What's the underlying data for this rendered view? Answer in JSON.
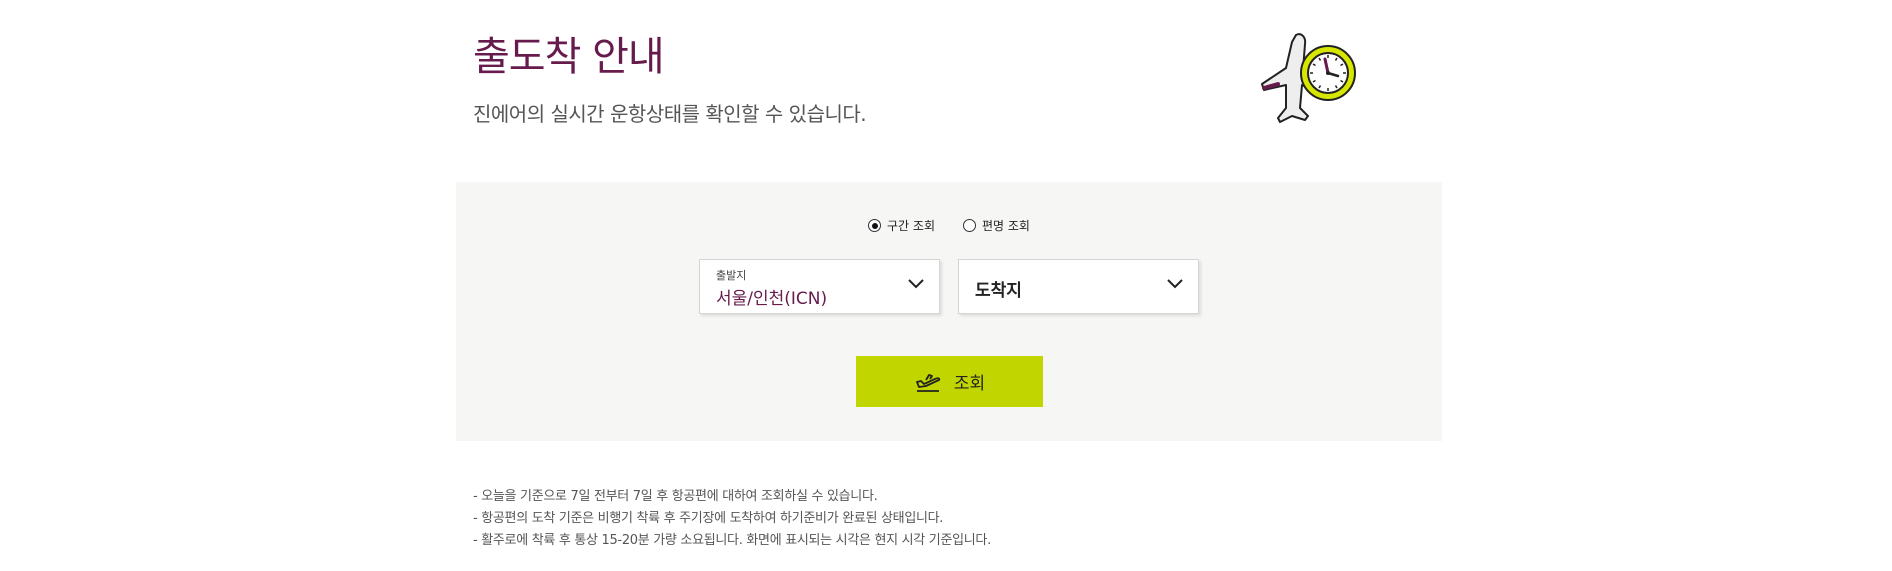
{
  "page": {
    "title": "출도착 안내",
    "subtitle": "진에어의 실시간 운항상태를 확인할 수 있습니다."
  },
  "search": {
    "modes": [
      {
        "label": "구간 조회",
        "selected": true
      },
      {
        "label": "편명 조회",
        "selected": false
      }
    ],
    "departure": {
      "label": "출발지",
      "value": "서울/인천(ICN)"
    },
    "arrival": {
      "placeholder": "도착지"
    },
    "button_label": "조회"
  },
  "notes": [
    "- 오늘을 기준으로 7일 전부터 7일 후 항공편에 대하여 조회하실 수 있습니다.",
    "- 항공편의 도착 기준은 비행기 착륙 후 주기장에 도착하여 하기준비가 완료된 상태입니다.",
    "- 활주로에 착륙 후 통상 15-20분 가량 소요됩니다. 화면에 표시되는 시각은 현지 시각 기준입니다."
  ],
  "colors": {
    "brand": "#661b4c",
    "accent": "#c1d600",
    "panel_bg": "#f6f6f4"
  }
}
